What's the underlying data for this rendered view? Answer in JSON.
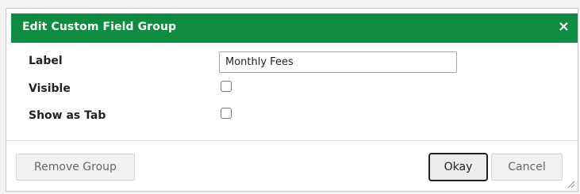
{
  "dialog": {
    "title": "Edit Custom Field Group",
    "close_glyph": "×",
    "accent_color": "#0e8c3f"
  },
  "form": {
    "label_field": {
      "label": "Label",
      "value": "Monthly Fees"
    },
    "visible_field": {
      "label": "Visible",
      "checked": false
    },
    "show_as_tab_field": {
      "label": "Show as Tab",
      "checked": false
    }
  },
  "buttons": {
    "remove_group": "Remove Group",
    "okay": "Okay",
    "cancel": "Cancel"
  },
  "icons": {
    "close": "close-icon",
    "resize": "resize-grip-icon"
  }
}
